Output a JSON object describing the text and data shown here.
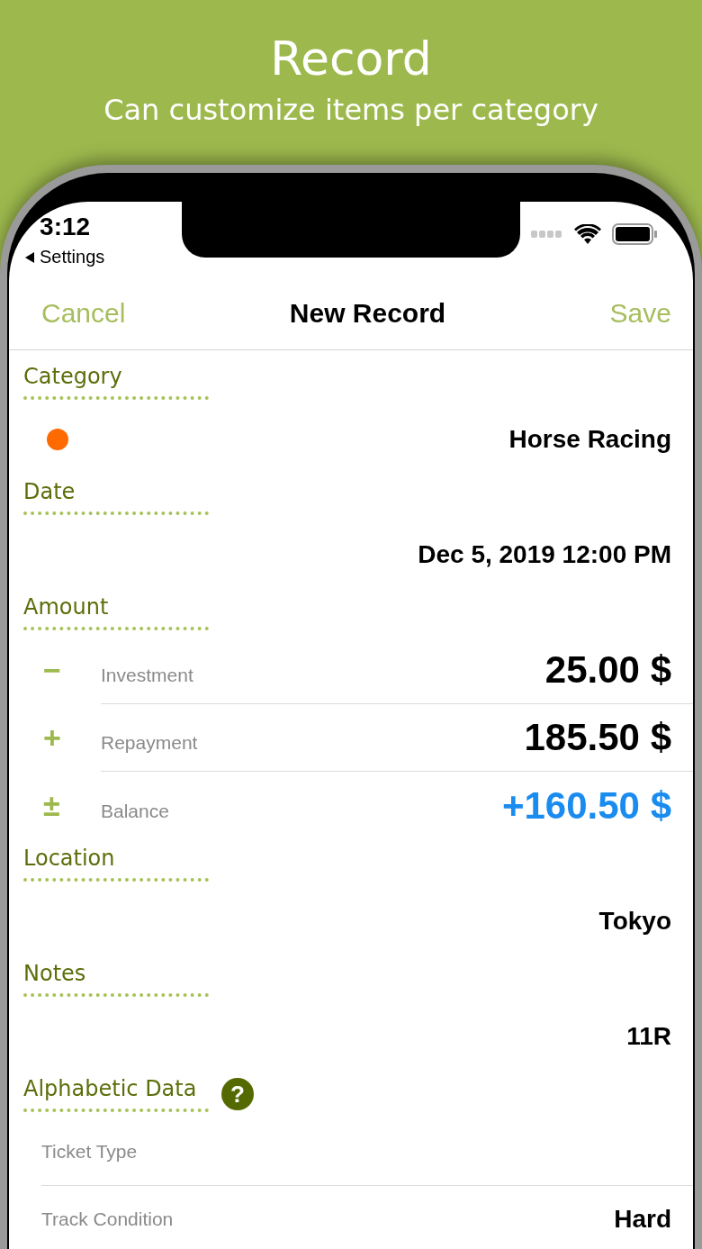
{
  "banner": {
    "title": "Record",
    "subtitle": "Can customize items per category"
  },
  "status_bar": {
    "time": "3:12",
    "back_label": "Settings"
  },
  "nav": {
    "cancel": "Cancel",
    "title": "New Record",
    "save": "Save"
  },
  "sections": [
    {
      "kind": "category",
      "title": "Category",
      "color": "#ff6a00",
      "value": "Horse Racing"
    },
    {
      "kind": "value",
      "title": "Date",
      "value": "Dec 5, 2019 12:00 PM"
    },
    {
      "kind": "amount",
      "title": "Amount",
      "rows": [
        {
          "sign": "−",
          "label": "Investment",
          "value": "25.00 $",
          "highlight": false
        },
        {
          "sign": "+",
          "label": "Repayment",
          "value": "185.50 $",
          "highlight": false
        },
        {
          "sign": "±",
          "label": "Balance",
          "value": "+160.50 $",
          "highlight": true
        }
      ]
    },
    {
      "kind": "value",
      "title": "Location",
      "value": "Tokyo"
    },
    {
      "kind": "value",
      "title": "Notes",
      "value": "11R"
    },
    {
      "kind": "fields",
      "title": "Alphabetic Data",
      "help": "?",
      "rows": [
        {
          "label": "Ticket Type"
        },
        {
          "label": "Track Condition",
          "value": "Hard"
        }
      ]
    }
  ]
}
